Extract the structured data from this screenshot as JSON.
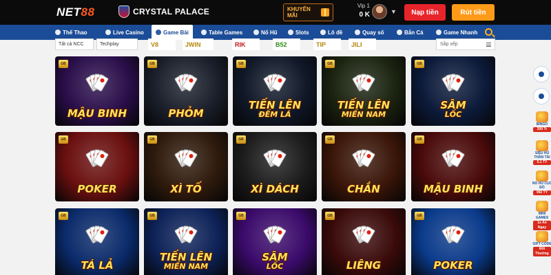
{
  "header": {
    "logo_text": "NET",
    "logo_accent": "88",
    "club_name": "CRYSTAL PALACE",
    "promo_label": "KHUYẾN MÃI",
    "vip_label": "Vip 1",
    "balance": "0 K",
    "deposit_label": "Nạp tiền",
    "withdraw_label": "Rút tiền"
  },
  "nav": {
    "items": [
      {
        "label": "Thể Thao",
        "icon": "soccer-ball-icon"
      },
      {
        "label": "Live Casino",
        "icon": "casino-chip-icon"
      },
      {
        "label": "Game Bài",
        "icon": "playing-cards-icon",
        "active": true
      },
      {
        "label": "Table Games",
        "icon": "table-icon"
      },
      {
        "label": "Nổ Hũ",
        "icon": "jackpot-icon"
      },
      {
        "label": "Slots",
        "icon": "slot-machine-icon"
      },
      {
        "label": "Lô đề",
        "icon": "lottery-icon"
      },
      {
        "label": "Quay số",
        "icon": "dice-icon"
      },
      {
        "label": "Bắn Cá",
        "icon": "fish-icon"
      },
      {
        "label": "Game Nhanh",
        "icon": "gamepad-icon"
      }
    ]
  },
  "filter": {
    "all_label": "Tất cả NCC",
    "providers": [
      "Techplay",
      "V8",
      "JWIN",
      "RIK",
      "B52",
      "TIP",
      "JILI"
    ],
    "sort_placeholder": "Sắp xếp"
  },
  "games": [
    {
      "title": "MẬU BINH",
      "subtitle": "",
      "bg": "#2a0e4a"
    },
    {
      "title": "PHỎM",
      "subtitle": "",
      "bg": "#1a1f2b"
    },
    {
      "title": "TIẾN LÊN",
      "subtitle": "ĐẾM LÁ",
      "bg": "#101828"
    },
    {
      "title": "TIẾN LÊN",
      "subtitle": "MIỀN NAM",
      "bg": "#1b2310"
    },
    {
      "title": "SÂM",
      "subtitle": "LỐC",
      "bg": "#0c1a3a"
    },
    {
      "title": "POKER",
      "subtitle": "",
      "bg": "#6a0f0f"
    },
    {
      "title": "XÌ TỐ",
      "subtitle": "",
      "bg": "#2e1a0c"
    },
    {
      "title": "XÌ DÁCH",
      "subtitle": "",
      "bg": "#1c1c1c"
    },
    {
      "title": "CHẮN",
      "subtitle": "",
      "bg": "#3a1508"
    },
    {
      "title": "MẬU BINH",
      "subtitle": "",
      "bg": "#4a0a0a"
    },
    {
      "title": "TÁ LẢ",
      "subtitle": "",
      "bg": "#0a2a6a"
    },
    {
      "title": "TIẾN LÊN",
      "subtitle": "MIỀN NAM",
      "bg": "#0d2258"
    },
    {
      "title": "SÂM",
      "subtitle": "LỐC",
      "bg": "#3a0a6a"
    },
    {
      "title": "LIÊNG",
      "subtitle": "",
      "bg": "#3a0a0a"
    },
    {
      "title": "POKER",
      "subtitle": "",
      "bg": "#0a3a8a"
    }
  ],
  "card_badge": "GB",
  "side_promos": [
    {
      "name": "BINGO",
      "value": "200 Tr"
    },
    {
      "name": "SIÊU HŨ THẦN TÀI",
      "value": "5.1 TỶ"
    },
    {
      "name": "NỔ HŨ CỤC ĐỎ",
      "value": "992 TỶ"
    },
    {
      "name": "MINI GAMES",
      "value": "1s Ăn Ngay"
    },
    {
      "name": "GIFT CODE",
      "value": "Đổi Thưởng"
    }
  ],
  "colors": {
    "header_bg": "#0b0b0b",
    "nav_bg": "#1b4c97",
    "deposit": "#e8242b",
    "withdraw": "#ff9a18",
    "title_gold": "#ffe35a"
  }
}
